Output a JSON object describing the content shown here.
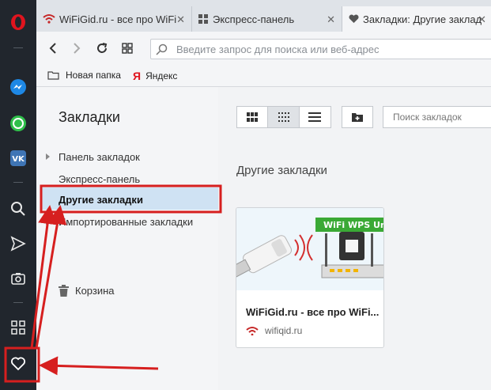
{
  "tabs": [
    {
      "label": "WiFiGid.ru - все про WiFi",
      "close": "✕"
    },
    {
      "label": "Экспресс-панель",
      "close": "✕"
    },
    {
      "label": "Закладки: Другие заклад",
      "close": "✕"
    }
  ],
  "toolbar": {
    "address_placeholder": "Введите запрос для поиска или веб-адрес"
  },
  "bookmarks_bar": {
    "items": [
      {
        "label": "Новая папка",
        "icon": "folder-icon"
      },
      {
        "label": "Яндекс",
        "icon": "yandex-icon"
      }
    ]
  },
  "sidebar": {
    "items": [
      "opera-logo",
      "messenger-icon",
      "whatsapp-icon",
      "vk-icon",
      "search-icon",
      "send-icon",
      "camera-icon",
      "grid-icon",
      "heart-icon"
    ],
    "vk_label": "VK"
  },
  "panel": {
    "title": "Закладки",
    "tree": [
      {
        "label": "Панель закладок",
        "expandable": true
      },
      {
        "label": "Экспресс-панель",
        "expandable": false
      },
      {
        "label": "Другие закладки",
        "expandable": false,
        "selected": true
      },
      {
        "label": "Импортированные закладки",
        "expandable": true
      }
    ],
    "trash_label": "Корзина"
  },
  "main": {
    "search_placeholder": "Поиск закладок",
    "folder_title": "Другие закладки",
    "cards": [
      {
        "title": "WiFiGid.ru - все про WiFi...",
        "url": "wifiqid.ru",
        "thumb_text": "WiFi WPS Un"
      }
    ]
  },
  "colors": {
    "sidebar_bg": "#21262d",
    "opera_red": "#e0141e",
    "selection": "#cfe2f3",
    "annotation_red": "#d61f1f"
  }
}
